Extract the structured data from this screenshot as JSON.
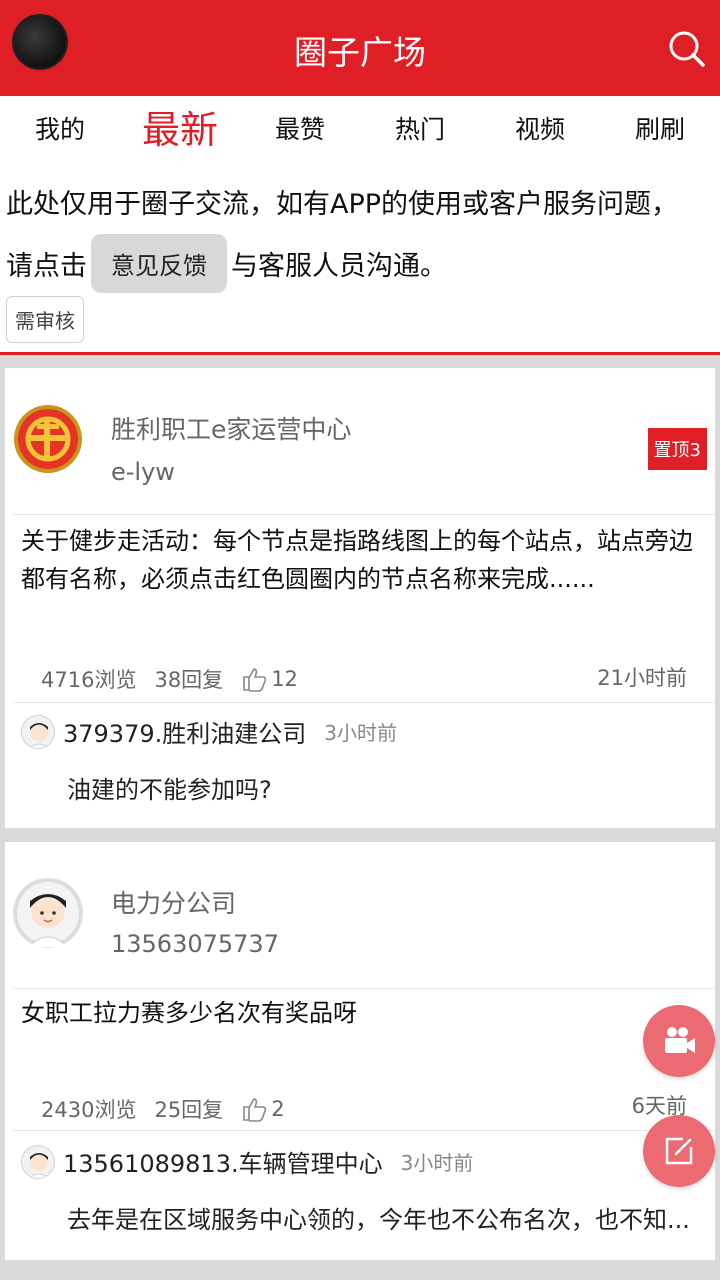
{
  "header": {
    "title": "圈子广场",
    "avatar_icon": "avatar-icon",
    "search_icon": "search-icon"
  },
  "tabs": [
    {
      "label": "我的"
    },
    {
      "label": "最新"
    },
    {
      "label": "最赞"
    },
    {
      "label": "热门"
    },
    {
      "label": "视频"
    },
    {
      "label": "刷刷"
    }
  ],
  "notice": {
    "line1": "此处仅用于圈子交流，如有APP的使用或客户服务问题，",
    "line2_prefix": "请点击",
    "feedback_button": "意见反馈",
    "line2_suffix": "与客服人员沟通。",
    "review_badge": "需审核"
  },
  "posts": [
    {
      "author": "胜利职工e家运营中心",
      "handle": "e-lyw",
      "pinned": "置顶3",
      "content": "关于健步走活动：每个节点是指路线图上的每个站点，站点旁边都有名称，必须点击红色圆圈内的节点名称来完成......",
      "views": "4716浏览",
      "replies": "38回复",
      "likes": "12",
      "time": "21小时前",
      "comment": {
        "name": "379379.胜利油建公司",
        "time": "3小时前",
        "text": "油建的不能参加吗?"
      }
    },
    {
      "author": "电力分公司",
      "handle": "13563075737",
      "content": "女职工拉力赛多少名次有奖品呀",
      "views": "2430浏览",
      "replies": "25回复",
      "likes": "2",
      "time": "6天前",
      "comment": {
        "name": "13561089813.车辆管理中心",
        "time": "3小时前",
        "text": "去年是在区域服务中心领的，今年也不公布名次，也不知..."
      }
    }
  ],
  "fabs": {
    "video": "video-camera-icon",
    "compose": "compose-icon"
  },
  "colors": {
    "brand": "#e01e25",
    "fab": "#ec6b73"
  }
}
